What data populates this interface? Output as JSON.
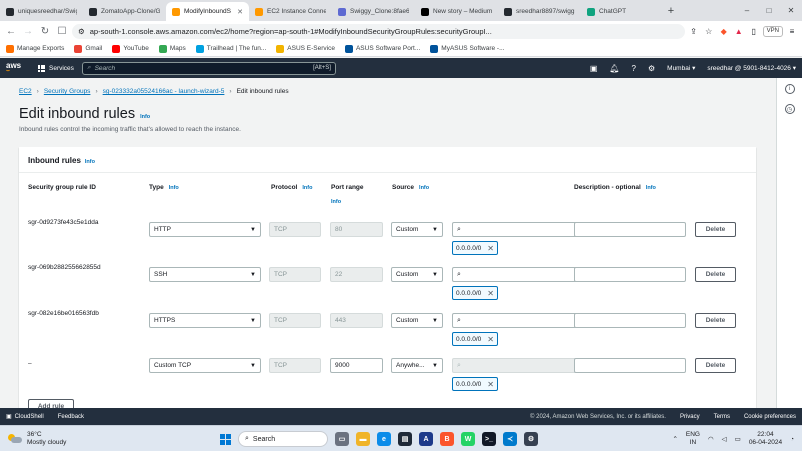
{
  "browser": {
    "tabs": [
      {
        "title": "uniquesreedhar/Swig",
        "color": "#24292f",
        "active": false
      },
      {
        "title": "ZomatoApp-Clone/G",
        "color": "#24292f",
        "active": false
      },
      {
        "title": "ModifyInboundS",
        "color": "#ff9900",
        "active": true
      },
      {
        "title": "EC2 Instance Conne",
        "color": "#ff9900",
        "active": false
      },
      {
        "title": "Swiggy_Clone:8fae6e",
        "color": "#5e6ad2",
        "active": false
      },
      {
        "title": "New story – Medium",
        "color": "#000000",
        "active": false
      },
      {
        "title": "sreedhar8897/swigg",
        "color": "#24292f",
        "active": false
      },
      {
        "title": "ChatGPT",
        "color": "#10a37f",
        "active": false
      }
    ],
    "url": "ap-south-1.console.aws.amazon.com/ec2/home?region=ap-south-1#ModifyInboundSecurityGroupRules:securityGroupI...",
    "vpn_label": "VPN",
    "bookmarks": [
      {
        "label": "Manage Exports",
        "color": "#ff6f00"
      },
      {
        "label": "Gmail",
        "color": "#ea4335"
      },
      {
        "label": "YouTube",
        "color": "#ff0000"
      },
      {
        "label": "Maps",
        "color": "#34a853"
      },
      {
        "label": "Trailhead | The fun...",
        "color": "#00a1e0"
      },
      {
        "label": "ASUS E-Service",
        "color": "#f2b400"
      },
      {
        "label": "ASUS Software Port...",
        "color": "#00539b"
      },
      {
        "label": "MyASUS Software -...",
        "color": "#00539b"
      }
    ]
  },
  "aws": {
    "logo": "aws",
    "services_label": "Services",
    "search_placeholder": "Search",
    "search_shortcut": "[Alt+S]",
    "region": "Mumbai ▾",
    "account": "sreedhar @ 5901-8412-4026 ▾"
  },
  "breadcrumbs": {
    "ec2": "EC2",
    "security_groups": "Security Groups",
    "sg": "sg-023332a05524166ac - launch-wizard-5",
    "current": "Edit inbound rules"
  },
  "page": {
    "title": "Edit inbound rules",
    "title_info": "Info",
    "subtitle": "Inbound rules control the incoming traffic that's allowed to reach the instance."
  },
  "panel": {
    "title": "Inbound rules",
    "info": "Info",
    "columns": {
      "id": "Security group rule ID",
      "type": "Type",
      "protocol": "Protocol",
      "port": "Port range",
      "source": "Source",
      "desc": "Description - optional",
      "info": "Info"
    },
    "rules": [
      {
        "id": "sgr-0d9273fe43c5e1dda",
        "type": "HTTP",
        "protocol": "TCP",
        "port": "80",
        "source": "Custom",
        "cidr": "0.0.0.0/0",
        "delete": "Delete"
      },
      {
        "id": "sgr-069b288255662855d",
        "type": "SSH",
        "protocol": "TCP",
        "port": "22",
        "source": "Custom",
        "cidr": "0.0.0.0/0",
        "delete": "Delete"
      },
      {
        "id": "sgr-082e16be016563fdb",
        "type": "HTTPS",
        "protocol": "TCP",
        "port": "443",
        "source": "Custom",
        "cidr": "0.0.0.0/0",
        "delete": "Delete"
      },
      {
        "id": "–",
        "type": "Custom TCP",
        "protocol": "TCP",
        "port": "9000",
        "source": "Anywhe...",
        "cidr": "0.0.0.0/0",
        "delete": "Delete"
      }
    ],
    "add_rule": "Add rule"
  },
  "footer": {
    "cloudshell": "CloudShell",
    "feedback": "Feedback",
    "copyright": "© 2024, Amazon Web Services, Inc. or its affiliates.",
    "privacy": "Privacy",
    "terms": "Terms",
    "cookies": "Cookie preferences"
  },
  "taskbar": {
    "temp": "36°C",
    "weather": "Mostly cloudy",
    "search": "Search",
    "lang1": "ENG",
    "lang2": "IN",
    "time": "22:04",
    "date": "06-04-2024"
  }
}
